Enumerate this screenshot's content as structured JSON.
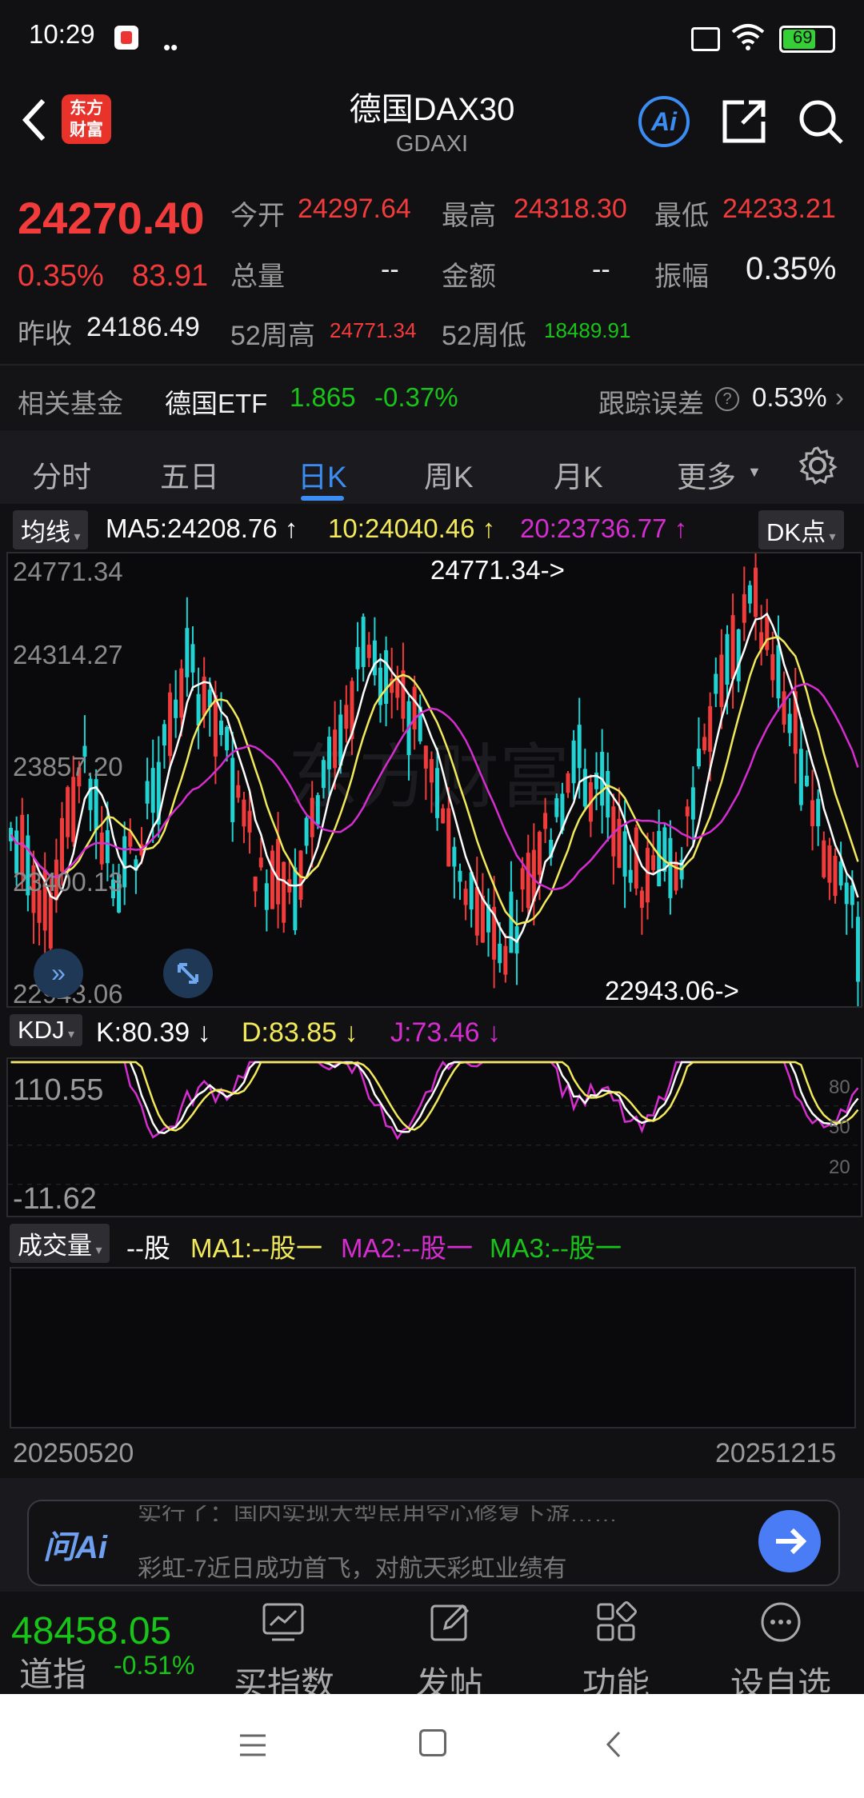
{
  "status": {
    "time": "10:29",
    "battery": "69"
  },
  "header": {
    "title": "德国DAX30",
    "subtitle": "GDAXI",
    "logo_line1": "东方",
    "logo_line2": "财富",
    "ai": "Ai"
  },
  "quote": {
    "price": "24270.40",
    "change_pct": "0.35%",
    "change": "83.91",
    "open_label": "今开",
    "open": "24297.64",
    "high_label": "最高",
    "high": "24318.30",
    "low_label": "最低",
    "low": "24233.21",
    "volume_label": "总量",
    "volume": "--",
    "amount_label": "金额",
    "amount": "--",
    "amplitude_label": "振幅",
    "amplitude": "0.35%",
    "prev_close_label": "昨收",
    "prev_close": "24186.49",
    "w52_high_label": "52周高",
    "w52_high": "24771.34",
    "w52_low_label": "52周低",
    "w52_low": "18489.91"
  },
  "fund": {
    "label": "相关基金",
    "name": "德国ETF",
    "price": "1.865",
    "change": "-0.37%",
    "tracking_label": "跟踪误差",
    "tracking": "0.53%"
  },
  "tabs": [
    "分时",
    "五日",
    "日K",
    "周K",
    "月K",
    "更多"
  ],
  "ma_bar": {
    "selector": "均线",
    "ma5": "MA5:24208.76",
    "ma10": "10:24040.46",
    "ma20": "20:23736.77",
    "dk": "DK点"
  },
  "price_axis": [
    "24771.34",
    "24314.27",
    "23857.20",
    "23400.13",
    "22943.06"
  ],
  "max_marker": "24771.34->",
  "min_marker": "22943.06->",
  "kdj_bar": {
    "selector": "KDJ",
    "k": "K:80.39",
    "d": "D:83.85",
    "j": "J:73.46"
  },
  "kdj_axis": {
    "top": "110.55",
    "bottom": "-11.62",
    "r80": "80",
    "r50": "50",
    "r20": "20"
  },
  "vol_bar": {
    "selector": "成交量",
    "vol": "--股",
    "ma1": "MA1:--股一",
    "ma2": "MA2:--股一",
    "ma3": "MA3:--股一"
  },
  "dates": {
    "start": "20250520",
    "end": "20251215"
  },
  "ai_bar": {
    "logo": "问Ai",
    "line1": "实行了：国内实现大型民用空心修复下游……",
    "line2": "彩虹-7近日成功首飞，对航天彩虹业绩有"
  },
  "bottom": {
    "index_value": "48458.05",
    "index_name": "道指",
    "index_change": "-0.51%",
    "tabs": [
      "买指数",
      "发帖",
      "功能",
      "设自选"
    ]
  },
  "colors": {
    "up": "#f23b3b",
    "down": "#22d3d3",
    "ma5": "#ffffff",
    "ma10": "#f2ea5a",
    "ma20": "#d62dd0",
    "accent": "#3b8df3"
  }
}
